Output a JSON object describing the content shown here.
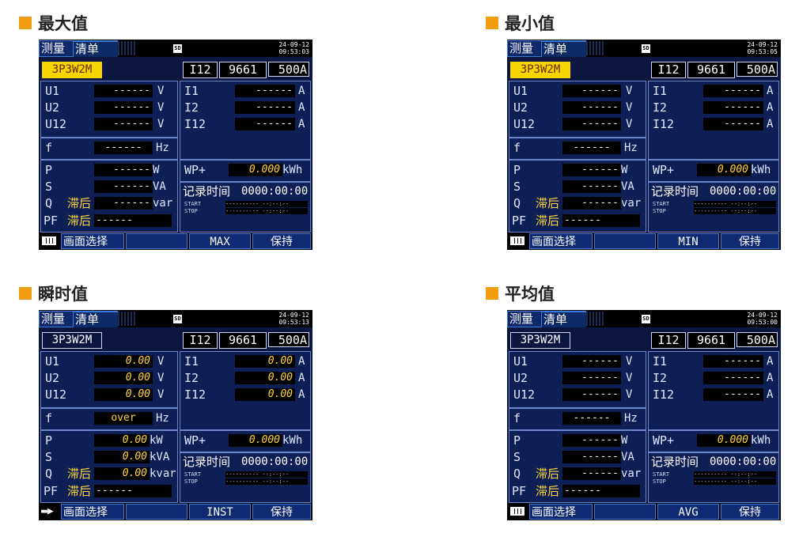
{
  "sections": [
    {
      "title": "最大值",
      "tabs": {
        "measure": "测量",
        "list": "清单"
      },
      "sd": "SD",
      "clock": {
        "date": "24-09-12",
        "time": "09:53:03"
      },
      "mode": "3P3W2M",
      "mode_highlight": true,
      "range": {
        "channel": "I12",
        "sensor": "9661",
        "current": "500A"
      },
      "left_rows": [
        {
          "label": "U1",
          "value": "------",
          "unit": "V"
        },
        {
          "label": "U2",
          "value": "------",
          "unit": "V"
        },
        {
          "label": "U12",
          "value": "------",
          "unit": "V"
        }
      ],
      "right_rows": [
        {
          "label": "I1",
          "value": "------",
          "unit": "A"
        },
        {
          "label": "I2",
          "value": "------",
          "unit": "A"
        },
        {
          "label": "I12",
          "value": "------",
          "unit": "A"
        }
      ],
      "freq": {
        "label": "f",
        "value": "------",
        "unit": "Hz"
      },
      "power_rows": [
        {
          "label": "P",
          "value": "------",
          "unit": "W",
          "lag": ""
        },
        {
          "label": "S",
          "value": "------",
          "unit": "VA",
          "lag": ""
        },
        {
          "label": "Q",
          "value": "------",
          "unit": "var",
          "lag": "滞后"
        }
      ],
      "pf": {
        "label": "PF",
        "lag": "滞后",
        "value": "------"
      },
      "wp": {
        "label": "WP+",
        "value": "0.000",
        "unit": "kWh"
      },
      "record": {
        "label": "记录时间",
        "value": "0000:00:00"
      },
      "start": {
        "label": "START",
        "value": "---------- --:--:--"
      },
      "stop": {
        "label": "STOP",
        "value": "---------- --:--:--"
      },
      "power_icon": "battery-icon",
      "fkeys": {
        "select": "画面选择",
        "func": "MAX",
        "hold": "保持"
      },
      "yellow_values": false
    },
    {
      "title": "最小值",
      "tabs": {
        "measure": "测量",
        "list": "清单"
      },
      "sd": "SD",
      "clock": {
        "date": "24-09-12",
        "time": "09:53:05"
      },
      "mode": "3P3W2M",
      "mode_highlight": true,
      "range": {
        "channel": "I12",
        "sensor": "9661",
        "current": "500A"
      },
      "left_rows": [
        {
          "label": "U1",
          "value": "------",
          "unit": "V"
        },
        {
          "label": "U2",
          "value": "------",
          "unit": "V"
        },
        {
          "label": "U12",
          "value": "------",
          "unit": "V"
        }
      ],
      "right_rows": [
        {
          "label": "I1",
          "value": "------",
          "unit": "A"
        },
        {
          "label": "I2",
          "value": "------",
          "unit": "A"
        },
        {
          "label": "I12",
          "value": "------",
          "unit": "A"
        }
      ],
      "freq": {
        "label": "f",
        "value": "------",
        "unit": "Hz"
      },
      "power_rows": [
        {
          "label": "P",
          "value": "------",
          "unit": "W",
          "lag": ""
        },
        {
          "label": "S",
          "value": "------",
          "unit": "VA",
          "lag": ""
        },
        {
          "label": "Q",
          "value": "------",
          "unit": "var",
          "lag": "滞后"
        }
      ],
      "pf": {
        "label": "PF",
        "lag": "滞后",
        "value": "------"
      },
      "wp": {
        "label": "WP+",
        "value": "0.000",
        "unit": "kWh"
      },
      "record": {
        "label": "记录时间",
        "value": "0000:00:00"
      },
      "start": {
        "label": "START",
        "value": "---------- --:--:--"
      },
      "stop": {
        "label": "STOP",
        "value": "---------- --:--:--"
      },
      "power_icon": "battery-icon",
      "fkeys": {
        "select": "画面选择",
        "func": "MIN",
        "hold": "保持"
      },
      "yellow_values": false
    },
    {
      "title": "瞬时值",
      "tabs": {
        "measure": "测量",
        "list": "清单"
      },
      "sd": "SD",
      "clock": {
        "date": "24-09-12",
        "time": "09:53:13"
      },
      "mode": "3P3W2M",
      "mode_highlight": false,
      "range": {
        "channel": "I12",
        "sensor": "9661",
        "current": "500A"
      },
      "left_rows": [
        {
          "label": "U1",
          "value": "0.00",
          "unit": "V"
        },
        {
          "label": "U2",
          "value": "0.00",
          "unit": "V"
        },
        {
          "label": "U12",
          "value": "0.00",
          "unit": "V"
        }
      ],
      "right_rows": [
        {
          "label": "I1",
          "value": "0.00",
          "unit": "A"
        },
        {
          "label": "I2",
          "value": "0.00",
          "unit": "A"
        },
        {
          "label": "I12",
          "value": "0.00",
          "unit": "A"
        }
      ],
      "freq": {
        "label": "f",
        "value": "over",
        "unit": "Hz"
      },
      "power_rows": [
        {
          "label": "P",
          "value": "0.00",
          "unit": "kW",
          "lag": ""
        },
        {
          "label": "S",
          "value": "0.00",
          "unit": "kVA",
          "lag": ""
        },
        {
          "label": "Q",
          "value": "0.00",
          "unit": "kvar",
          "lag": "滞后"
        }
      ],
      "pf": {
        "label": "PF",
        "lag": "滞后",
        "value": "------"
      },
      "wp": {
        "label": "WP+",
        "value": "0.000",
        "unit": "kWh"
      },
      "record": {
        "label": "记录时间",
        "value": "0000:00:00"
      },
      "start": {
        "label": "START",
        "value": "---------- --:--:--"
      },
      "stop": {
        "label": "STOP",
        "value": "---------- --:--:--"
      },
      "power_icon": "ac-plug-icon",
      "fkeys": {
        "select": "画面选择",
        "func": "INST",
        "hold": "保持"
      },
      "yellow_values": true
    },
    {
      "title": "平均值",
      "tabs": {
        "measure": "测量",
        "list": "清单"
      },
      "sd": "SD",
      "clock": {
        "date": "24-09-12",
        "time": "09:53:00"
      },
      "mode": "3P3W2M",
      "mode_highlight": false,
      "range": {
        "channel": "I12",
        "sensor": "9661",
        "current": "500A"
      },
      "left_rows": [
        {
          "label": "U1",
          "value": "------",
          "unit": "V"
        },
        {
          "label": "U2",
          "value": "------",
          "unit": "V"
        },
        {
          "label": "U12",
          "value": "------",
          "unit": "V"
        }
      ],
      "right_rows": [
        {
          "label": "I1",
          "value": "------",
          "unit": "A"
        },
        {
          "label": "I2",
          "value": "------",
          "unit": "A"
        },
        {
          "label": "I12",
          "value": "------",
          "unit": "A"
        }
      ],
      "freq": {
        "label": "f",
        "value": "------",
        "unit": "Hz"
      },
      "power_rows": [
        {
          "label": "P",
          "value": "------",
          "unit": "W",
          "lag": ""
        },
        {
          "label": "S",
          "value": "------",
          "unit": "VA",
          "lag": ""
        },
        {
          "label": "Q",
          "value": "------",
          "unit": "var",
          "lag": "滞后"
        }
      ],
      "pf": {
        "label": "PF",
        "lag": "滞后",
        "value": "------"
      },
      "wp": {
        "label": "WP+",
        "value": "0.000",
        "unit": "kWh"
      },
      "record": {
        "label": "记录时间",
        "value": "0000:00:00"
      },
      "start": {
        "label": "START",
        "value": "---------- --:--:--"
      },
      "stop": {
        "label": "STOP",
        "value": "---------- --:--:--"
      },
      "power_icon": "battery-icon",
      "fkeys": {
        "select": "画面选择",
        "func": "AVG",
        "hold": "保持"
      },
      "yellow_values": false
    }
  ]
}
